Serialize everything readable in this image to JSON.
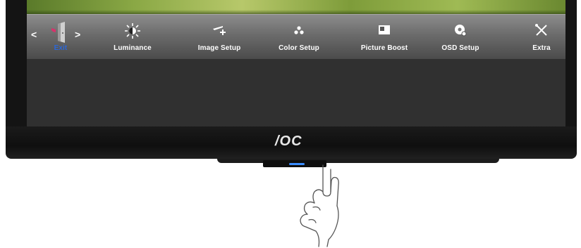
{
  "monitor": {
    "brand_logo": "/ΟC"
  },
  "osd": {
    "menu": [
      {
        "id": "exit",
        "label": "Exit",
        "icon": "exit-door-icon",
        "selected": true
      },
      {
        "id": "luminance",
        "label": "Luminance",
        "icon": "brightness-icon",
        "selected": false
      },
      {
        "id": "image_setup",
        "label": "Image Setup",
        "icon": "image-setup-icon",
        "selected": false
      },
      {
        "id": "color_setup",
        "label": "Color Setup",
        "icon": "color-setup-icon",
        "selected": false
      },
      {
        "id": "picture_boost",
        "label": "Picture Boost",
        "icon": "picture-boost-icon",
        "selected": false
      },
      {
        "id": "osd_setup",
        "label": "OSD Setup",
        "icon": "osd-setup-icon",
        "selected": false
      },
      {
        "id": "extra",
        "label": "Extra",
        "icon": "extra-tools-icon",
        "selected": false
      }
    ],
    "nav": {
      "left": "<",
      "right": ">"
    },
    "colors": {
      "selected_label": "#2b67d9",
      "bar_top": "#8c8c8c",
      "bar_bottom": "#4a4a4a"
    }
  }
}
